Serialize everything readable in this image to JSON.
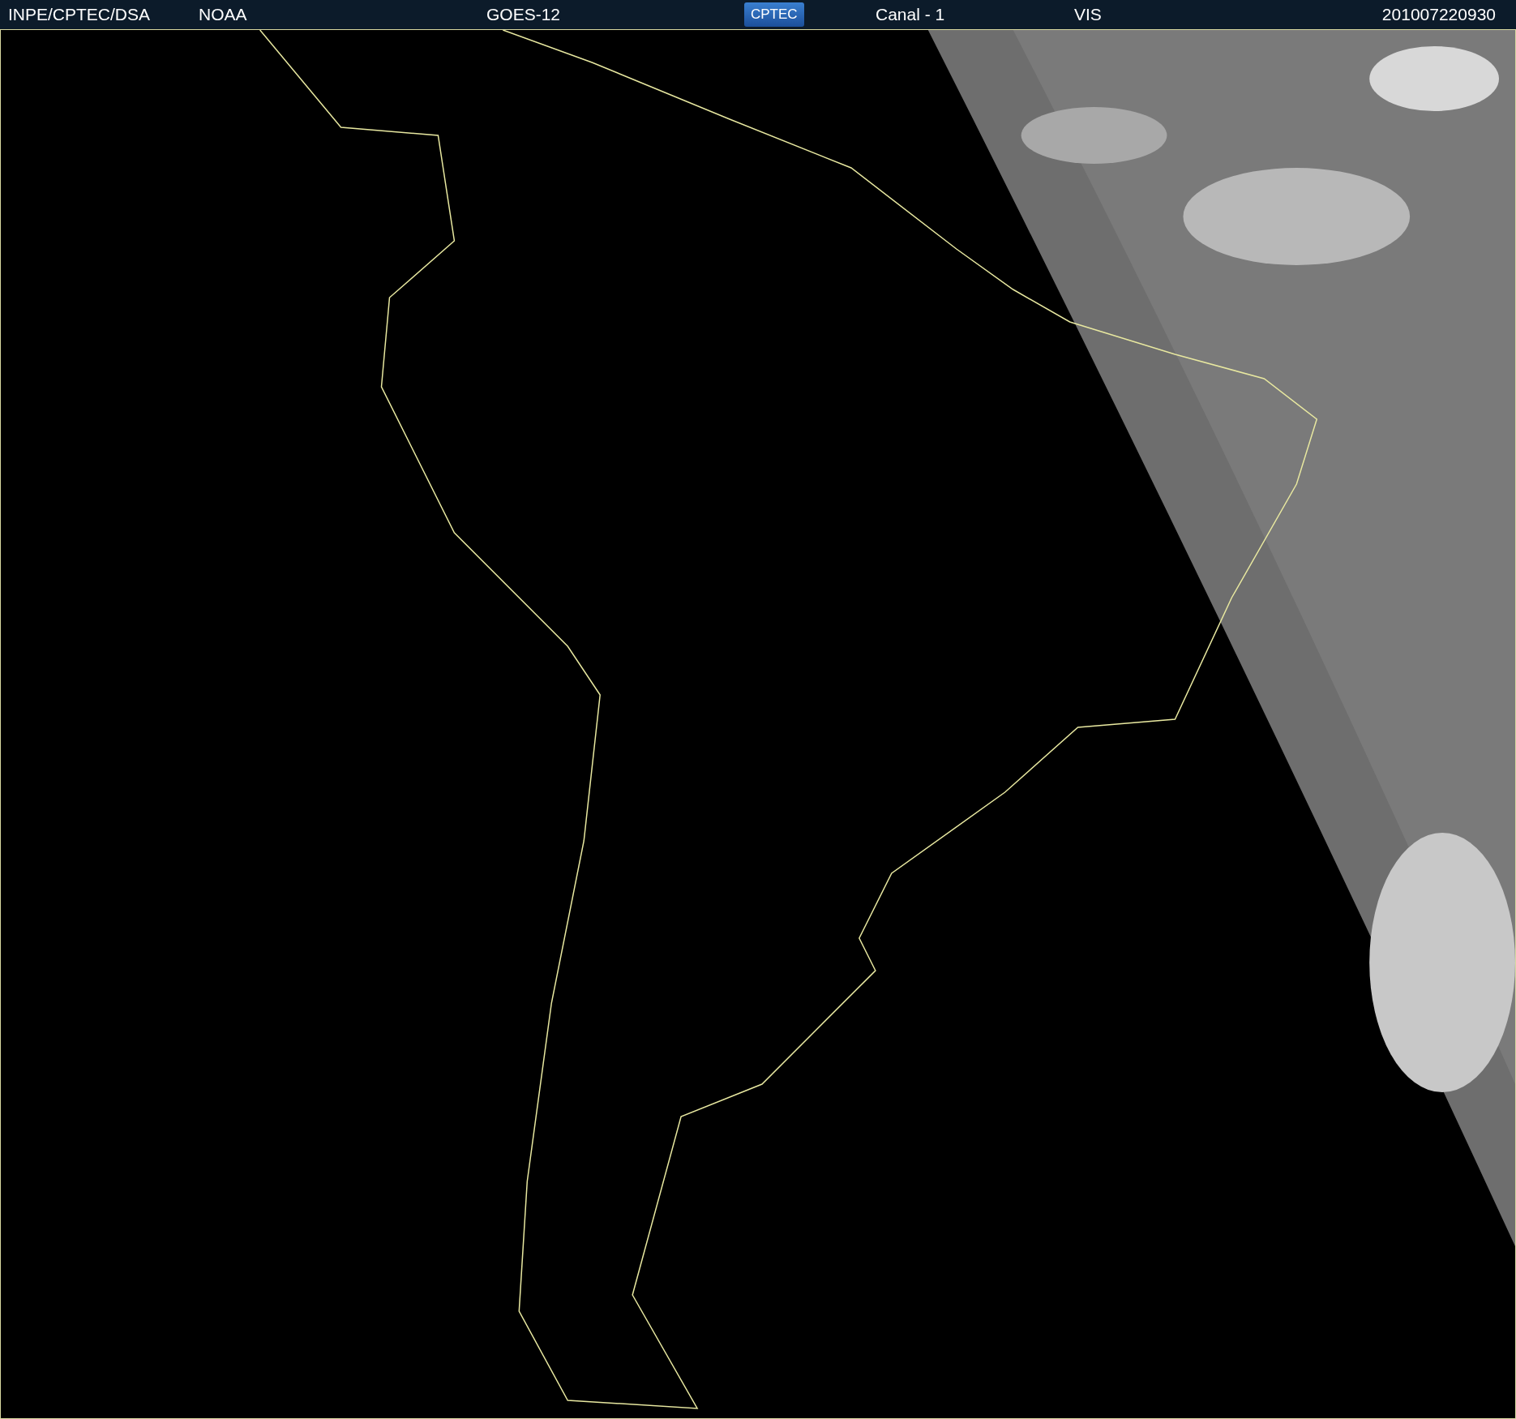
{
  "header": {
    "items": [
      {
        "kind": "text",
        "text": "INPE/CPTEC/DSA"
      },
      {
        "kind": "text",
        "text": "NOAA"
      },
      {
        "kind": "text",
        "text": "GOES-12"
      },
      {
        "kind": "logo",
        "text": "CPTEC"
      },
      {
        "kind": "text",
        "text": "Canal - 1"
      },
      {
        "kind": "text",
        "text": "VIS"
      },
      {
        "kind": "text",
        "text": "201007220930"
      }
    ]
  }
}
